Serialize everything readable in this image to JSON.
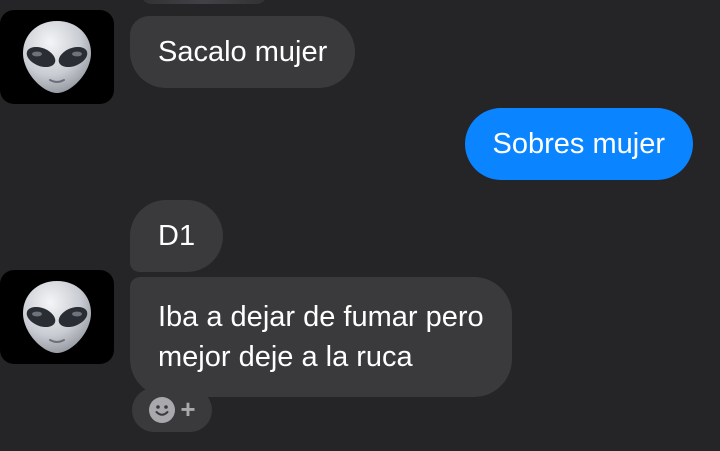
{
  "messages": [
    {
      "direction": "incoming",
      "text": "Sacalo mujer"
    },
    {
      "direction": "outgoing",
      "text": "Sobres mujer"
    },
    {
      "direction": "incoming",
      "text": "D1"
    },
    {
      "direction": "incoming",
      "lines": [
        "Iba a dejar de fumar pero",
        "mejor deje a la ruca"
      ]
    }
  ],
  "sender": {
    "avatar_icon": "alien-emoji-icon"
  },
  "reaction": {
    "icons": [
      "smiley-face-icon",
      "plus-icon"
    ],
    "plus_glyph": "+"
  },
  "colors": {
    "background": "#252527",
    "incoming_bubble": "#3a3a3c",
    "outgoing_bubble": "#0a84ff",
    "text": "#ffffff"
  }
}
